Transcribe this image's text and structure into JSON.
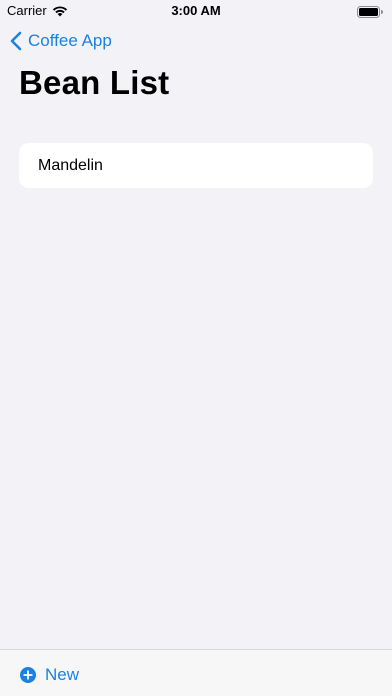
{
  "status_bar": {
    "carrier": "Carrier",
    "time": "3:00 AM"
  },
  "navigation": {
    "back_label": "Coffee App",
    "back_icon": "chevron-left-icon"
  },
  "page": {
    "title": "Bean List"
  },
  "list": {
    "items": [
      {
        "label": "Mandelin"
      }
    ]
  },
  "toolbar": {
    "new_label": "New",
    "new_icon": "plus-circle-icon"
  },
  "colors": {
    "accent": "#1a82e2",
    "background": "#f2f2f7",
    "card": "#ffffff"
  }
}
